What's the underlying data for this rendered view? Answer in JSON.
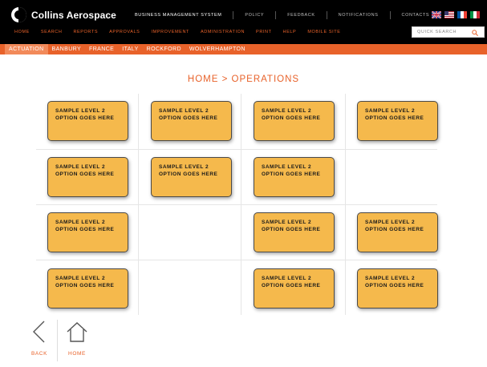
{
  "brand": {
    "name": "Collins Aerospace"
  },
  "header": {
    "links": [
      "Business Management System",
      "Policy",
      "Feedback",
      "Notifications",
      "Contacts"
    ],
    "flags": [
      "uk-flag-icon",
      "us-flag-icon",
      "france-flag-icon",
      "italy-flag-icon"
    ]
  },
  "main_nav": [
    "Home",
    "Search",
    "Reports",
    "Approvals",
    "Improvement",
    "Administration",
    "Print",
    "Help",
    "Mobile Site"
  ],
  "search": {
    "placeholder": "QUICK SEARCH",
    "icon": "search-icon"
  },
  "sub_nav": {
    "items": [
      "Actuation",
      "Banbury",
      "France",
      "Italy",
      "Rockford",
      "Wolverhampton"
    ],
    "active": "Actuation"
  },
  "page": {
    "title": "HOME > OPERATIONS"
  },
  "tiles": {
    "line1": "SAMPLE LEVEL 2",
    "line2": "OPTION GOES HERE",
    "rows": [
      [
        true,
        true,
        true,
        true
      ],
      [
        true,
        true,
        true,
        false
      ],
      [
        true,
        false,
        true,
        true
      ],
      [
        true,
        false,
        true,
        true
      ]
    ]
  },
  "bottom_nav": {
    "back": "BACK",
    "home": "HOME"
  },
  "colors": {
    "accent": "#e8622a",
    "tile": "#f5b94c",
    "header_bg": "#000000"
  }
}
